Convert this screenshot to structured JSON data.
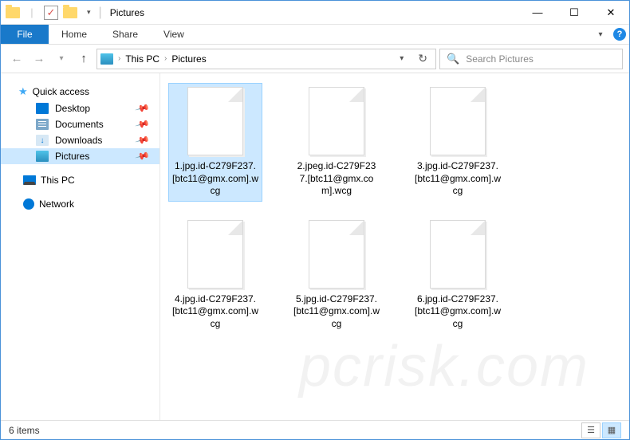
{
  "window": {
    "title": "Pictures"
  },
  "ribbon": {
    "file_label": "File",
    "tabs": [
      "Home",
      "Share",
      "View"
    ]
  },
  "breadcrumb": {
    "items": [
      "This PC",
      "Pictures"
    ]
  },
  "search": {
    "placeholder": "Search Pictures"
  },
  "navpane": {
    "quick_access": "Quick access",
    "quick_items": [
      {
        "label": "Desktop",
        "icon": "desktop",
        "pinned": true
      },
      {
        "label": "Documents",
        "icon": "doc",
        "pinned": true
      },
      {
        "label": "Downloads",
        "icon": "down",
        "pinned": true
      },
      {
        "label": "Pictures",
        "icon": "pic",
        "pinned": true,
        "selected": true
      }
    ],
    "this_pc": "This PC",
    "network": "Network"
  },
  "files": [
    {
      "name": "1.jpg.id-C279F237.[btc11@gmx.com].wcg",
      "selected": true
    },
    {
      "name": "2.jpeg.id-C279F237.[btc11@gmx.com].wcg"
    },
    {
      "name": "3.jpg.id-C279F237.[btc11@gmx.com].wcg"
    },
    {
      "name": "4.jpg.id-C279F237.[btc11@gmx.com].wcg"
    },
    {
      "name": "5.jpg.id-C279F237.[btc11@gmx.com].wcg"
    },
    {
      "name": "6.jpg.id-C279F237.[btc11@gmx.com].wcg"
    }
  ],
  "status": {
    "count_label": "6 items"
  }
}
